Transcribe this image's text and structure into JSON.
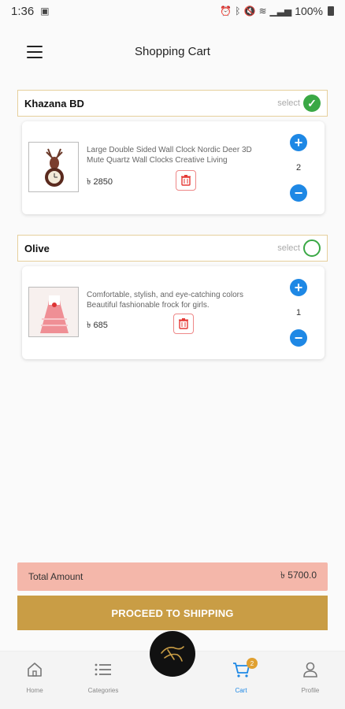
{
  "status_bar": {
    "time": "1:36",
    "battery": "100%"
  },
  "header": {
    "title": "Shopping Cart"
  },
  "shops": [
    {
      "name": "Khazana BD",
      "select_label": "select",
      "selected": true,
      "item": {
        "description": "Large Double Sided Wall Clock Nordic Deer 3D Mute Quartz Wall Clocks Creative Living",
        "price": "৳ 2850",
        "quantity": "2"
      }
    },
    {
      "name": "Olive",
      "select_label": "select",
      "selected": false,
      "item": {
        "description": "Comfortable, stylish, and eye-catching colors Beautiful fashionable frock for girls.",
        "price": "৳ 685",
        "quantity": "1"
      }
    }
  ],
  "total": {
    "label": "Total Amount",
    "value": "৳ 5700.0"
  },
  "proceed_label": "PROCEED TO SHIPPING",
  "bottom_nav": {
    "home": "Home",
    "categories": "Categories",
    "cart": "Cart",
    "cart_badge": "2",
    "profile": "Profile"
  },
  "colors": {
    "accent_gold": "#c99d45",
    "total_bg": "#f4b7aa",
    "select_green": "#3aa845",
    "qty_blue": "#1e88e5"
  }
}
